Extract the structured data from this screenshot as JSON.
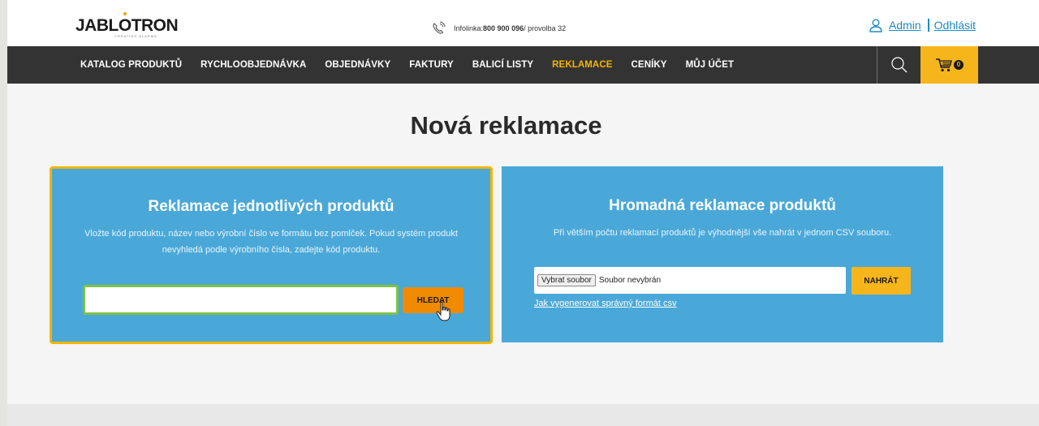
{
  "header": {
    "logo_text": "JABL",
    "logo_text_o": "O",
    "logo_text_end": "TRON",
    "logo_subtitle": "CREATING ALARMS",
    "hotline_label": "Infolinka: ",
    "hotline_number": "800 900 096",
    "hotline_extension": " / provolba 32",
    "user_link": "Admin",
    "logout_link": "Odhlásit"
  },
  "nav": {
    "items": [
      {
        "label": "KATALOG PRODUKTŮ",
        "active": false
      },
      {
        "label": "RYCHLOOBJEDNÁVKA",
        "active": false
      },
      {
        "label": "OBJEDNÁVKY",
        "active": false
      },
      {
        "label": "FAKTURY",
        "active": false
      },
      {
        "label": "BALICÍ LISTY",
        "active": false
      },
      {
        "label": "REKLAMACE",
        "active": true
      },
      {
        "label": "CENÍKY",
        "active": false
      },
      {
        "label": "MŮJ ÚČET",
        "active": false
      }
    ],
    "cart_count": "0"
  },
  "page": {
    "title": "Nová reklamace"
  },
  "single_claim": {
    "title": "Reklamace jednotlivých produktů",
    "description": "Vložte kód produktu, název nebo výrobní číslo ve formátu bez pomlček. Pokud systém produkt nevyhledá podle výrobního čísla, zadejte kód produktu.",
    "input_value": "",
    "search_button": "HLEDAT"
  },
  "bulk_claim": {
    "title": "Hromadná reklamace produktů",
    "description": "Při větším počtu reklamací produktů je výhodnější vše nahrát v jednom CSV souboru.",
    "file_button": "Vybrat soubor",
    "file_status": "Soubor nevybrán",
    "upload_button": "NAHRÁT",
    "csv_link": "Jak vygenerovat správný formát csv"
  },
  "colors": {
    "accent": "#f4b400",
    "panel": "#4aa8d8",
    "nav_bg": "#333333",
    "link": "#1d8ac8",
    "search_button": "#f08a00",
    "input_focus": "#7fc241"
  }
}
